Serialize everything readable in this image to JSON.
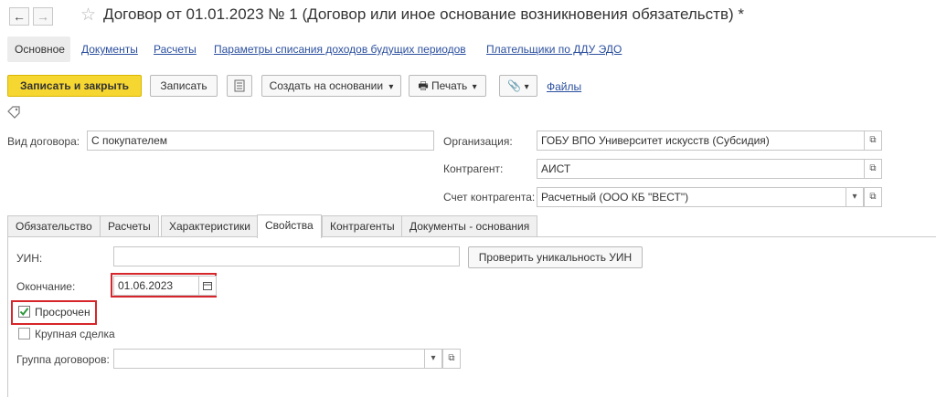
{
  "window": {
    "title": "Договор от 01.01.2023 № 1 (Договор или иное основание возникновения обязательств) *",
    "back_icon": "←",
    "forward_icon": "→",
    "star_icon": "☆"
  },
  "top_tabs": {
    "active": "Основное",
    "links": [
      "Документы",
      "Расчеты",
      "Параметры списания доходов будущих периодов",
      "Плательщики по ДДУ ЭДО"
    ]
  },
  "toolbar": {
    "save_close": "Записать и закрыть",
    "save": "Записать",
    "create_based": "Создать на основании",
    "print": "Печать",
    "files": "Файлы",
    "dropdown_arrow": "▾"
  },
  "form": {
    "contract_type_label": "Вид договора:",
    "contract_type_value": "С покупателем",
    "org_label": "Организация:",
    "org_value": "ГОБУ ВПО Университет искусств (Субсидия)",
    "counterparty_label": "Контрагент:",
    "counterparty_value": "АИСТ",
    "account_label": "Счет контрагента:",
    "account_value": "Расчетный (ООО КБ \"ВЕСТ\")",
    "open_icon": "⧉"
  },
  "tabs": [
    "Обязательство",
    "Расчеты",
    "Характеристики",
    "Свойства",
    "Контрагенты",
    "Документы - основания"
  ],
  "properties": {
    "uin_label": "УИН:",
    "uin_value": "",
    "check_uin_button": "Проверить уникальность УИН",
    "end_label": "Окончание:",
    "end_value": "01.06.2023",
    "overdue_label": "Просрочен",
    "overdue_checked": true,
    "large_deal_label": "Крупная сделка",
    "large_deal_checked": false,
    "group_label": "Группа договоров:",
    "group_value": ""
  },
  "colors": {
    "accent_yellow": "#f6d631",
    "highlight_red": "#d7262b",
    "link_blue": "#2b4f9e"
  }
}
